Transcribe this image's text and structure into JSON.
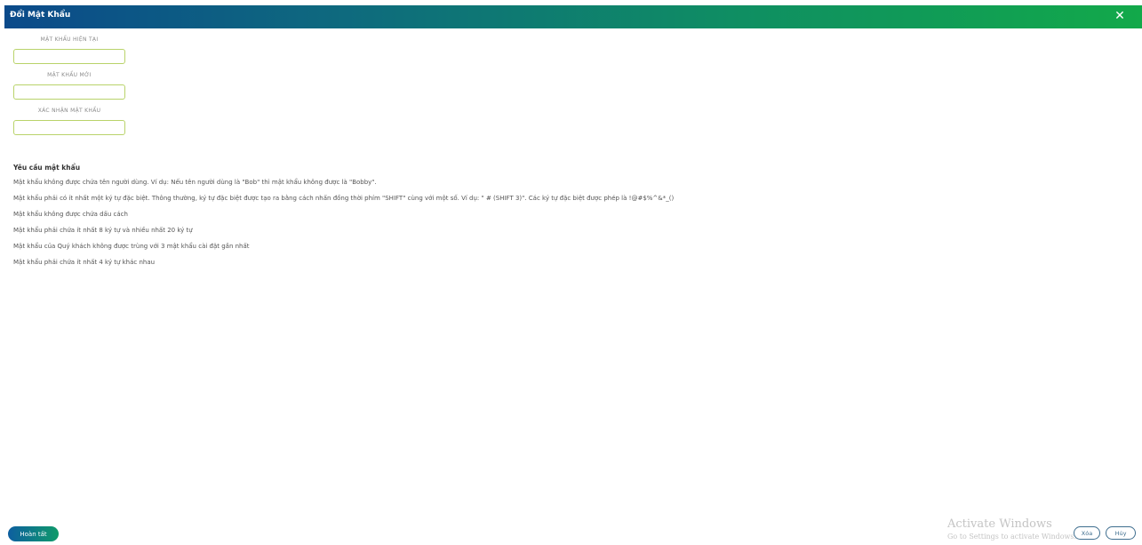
{
  "dialog": {
    "title": "Đổi Mật Khẩu",
    "close_symbol": "✕"
  },
  "form": {
    "fields": [
      {
        "label": "MẬT KHẨU HIỆN TẠI",
        "value": ""
      },
      {
        "label": "MẬT KHẨU MỚI",
        "value": ""
      },
      {
        "label": "XÁC NHẬN MẬT KHẨU",
        "value": ""
      }
    ]
  },
  "requirements": {
    "title": "Yêu cầu mật khẩu",
    "items": [
      "Mật khẩu không được chứa tên người dùng. Ví dụ: Nếu tên người dùng là \"Bob\" thì mật khẩu không được là \"Bobby\".",
      "Mật khẩu phải có ít nhất một ký tự đặc biệt. Thông thường, ký tự đặc biệt được tạo ra bằng cách nhấn đồng thời phím \"SHIFT\" cùng với một số. Ví dụ: \" # (SHIFT 3)\". Các ký tự đặc biệt được phép là !@#$%^&*_()",
      "Mật khẩu không được chứa dấu cách",
      "Mật khẩu phải chứa ít nhất 8 ký tự và nhiều nhất 20 ký tự",
      "Mật khẩu của Quý khách không được trùng với 3 mật khẩu cài đặt gần nhất",
      "Mật khẩu phải chứa ít nhất 4 ký tự khác nhau"
    ]
  },
  "footer": {
    "finish_label": "Hoàn tất",
    "watermark_title": "Activate Windows",
    "watermark_sub": "Go to Settings to activate Windows.",
    "pill_1": "Xóa",
    "pill_2": "Hủy"
  }
}
